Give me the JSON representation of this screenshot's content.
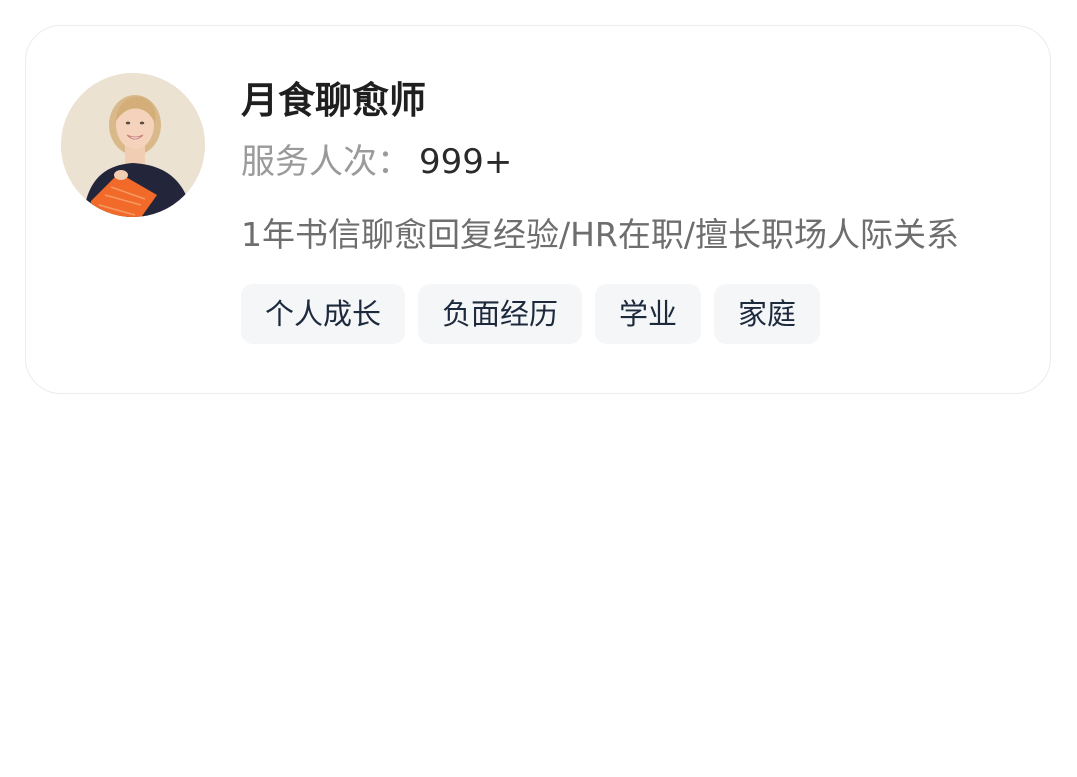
{
  "counselor": {
    "name": "月食聊愈师",
    "served_label": "服务人次：",
    "served_count": "999+",
    "description": "1年书信聊愈回复经验/HR在职/擅长职场人际关系",
    "tags": [
      "个人成长",
      "负面经历",
      "学业",
      "家庭"
    ]
  },
  "colors": {
    "tag_background": "#f5f6f8",
    "tag_text": "#1d2a3d",
    "card_border": "#ececec",
    "accent_orange": "#f26a2a"
  }
}
